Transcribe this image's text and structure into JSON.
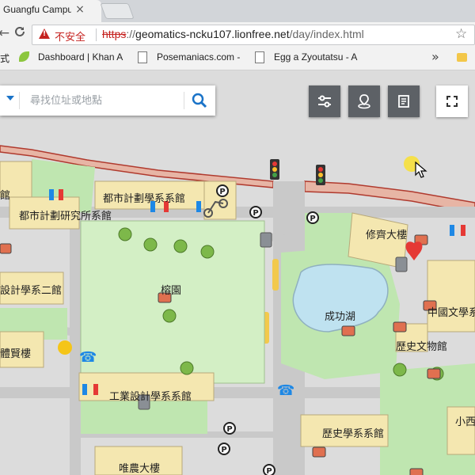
{
  "browser": {
    "tab_title": "Guangfu Campus",
    "tab_close": "×",
    "security_label": "不安全",
    "url_scheme": "https",
    "url_sep": "://",
    "url_host": "geomatics-ncku107.lionfree.net",
    "url_path": "/day/index.html",
    "star_icon": "☆",
    "back": "←",
    "reload": "C",
    "bookmarks": [
      {
        "label": "式"
      },
      {
        "label": "Dashboard | Khan A"
      },
      {
        "label": "Posemaniacs.com -"
      },
      {
        "label": "Egg a Zyoutatsu - A"
      }
    ],
    "bookmarks_more": "»"
  },
  "map": {
    "search_placeholder": "尋找位址或地點",
    "search_value": "",
    "labels": {
      "urban_planning_bldg": "都市計劃學系系館",
      "urban_planning_inst": "都市計劃研究所系館",
      "design_bldg_2": "設計學系二館",
      "jingyuan": "榕園",
      "xiuqi_bldg": "修齊大樓",
      "chenggong_lake": "成功湖",
      "chinese_lit_bldg": "中國文學系",
      "history_museum": "歷史文物館",
      "sixian_bldg": "體賢樓",
      "industrial_design_bldg": "工業設計學系系館",
      "history_dept_bldg": "歷史學系系館",
      "weinong_bldg": "唯農大樓",
      "xiaoxi": "小西"
    },
    "colors": {
      "building": "#f4e7b0",
      "grass": "#bfe6b0",
      "lawn": "#d3efc5",
      "road": "#c9c9c9",
      "boundary": "#c0392b",
      "water": "#bfe2f0",
      "tree": "#7db84a"
    },
    "icons": [
      "traffic-light-icon",
      "parking-icon",
      "restroom-icon",
      "camera-icon",
      "trash-icon",
      "phone-icon",
      "aed-icon",
      "bicycle-icon"
    ]
  }
}
